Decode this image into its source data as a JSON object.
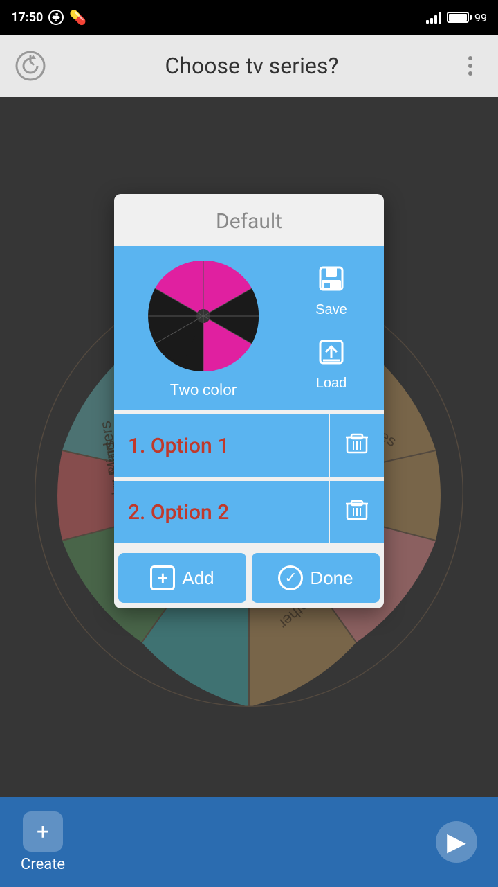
{
  "statusBar": {
    "time": "17:50",
    "battery": "99"
  },
  "topBar": {
    "title": "Choose tv series?"
  },
  "modal": {
    "title": "Default",
    "colorLabel": "Two color",
    "saveLabel": "Save",
    "loadLabel": "Load",
    "options": [
      {
        "number": "1.",
        "name": "Option 1"
      },
      {
        "number": "2.",
        "name": "Option 2"
      }
    ],
    "addLabel": "Add",
    "doneLabel": "Done"
  },
  "bottomBar": {
    "createLabel": "Create",
    "startLabel": "Start"
  }
}
